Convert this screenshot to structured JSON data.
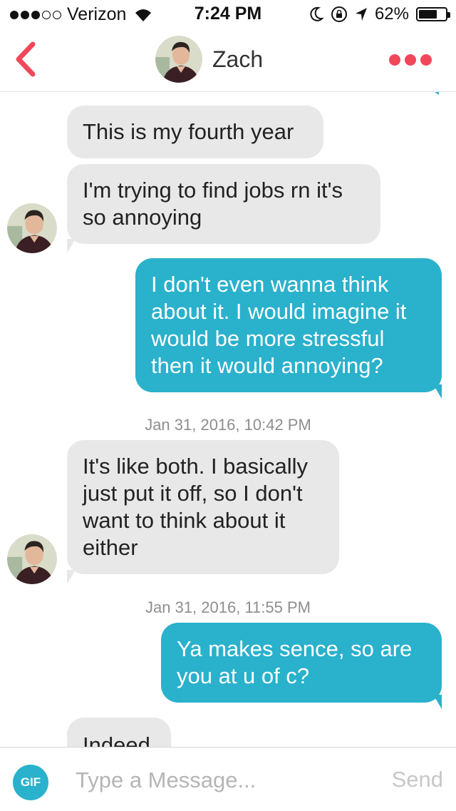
{
  "status_bar": {
    "carrier": "Verizon",
    "time": "7:24 PM",
    "battery": "62%",
    "battery_level": 0.62
  },
  "header": {
    "contact_name": "Zach",
    "accent_color": "#f0475b"
  },
  "messages": [
    {
      "side": "in",
      "text": "This is my fourth year"
    },
    {
      "side": "in",
      "text": "I'm trying to find jobs rn it's so annoying"
    },
    {
      "side": "out",
      "text": "I don't even wanna think about it. I would imagine it would be more stressful then it would annoying?"
    },
    {
      "side": "in",
      "text": "It's like both. I basically just put it off, so I don't want to think about it either"
    },
    {
      "side": "out",
      "text": "Ya makes sence, so are you at u of c?"
    },
    {
      "side": "in",
      "text": "Indeed"
    }
  ],
  "timestamps": [
    "Jan 31, 2016, 10:42 PM",
    "Jan 31, 2016, 11:55 PM"
  ],
  "composer": {
    "gif_label": "GIF",
    "placeholder": "Type a Message...",
    "send_label": "Send"
  },
  "colors": {
    "outgoing_bubble": "#2ab1cc",
    "incoming_bubble": "#e8e8e8"
  }
}
